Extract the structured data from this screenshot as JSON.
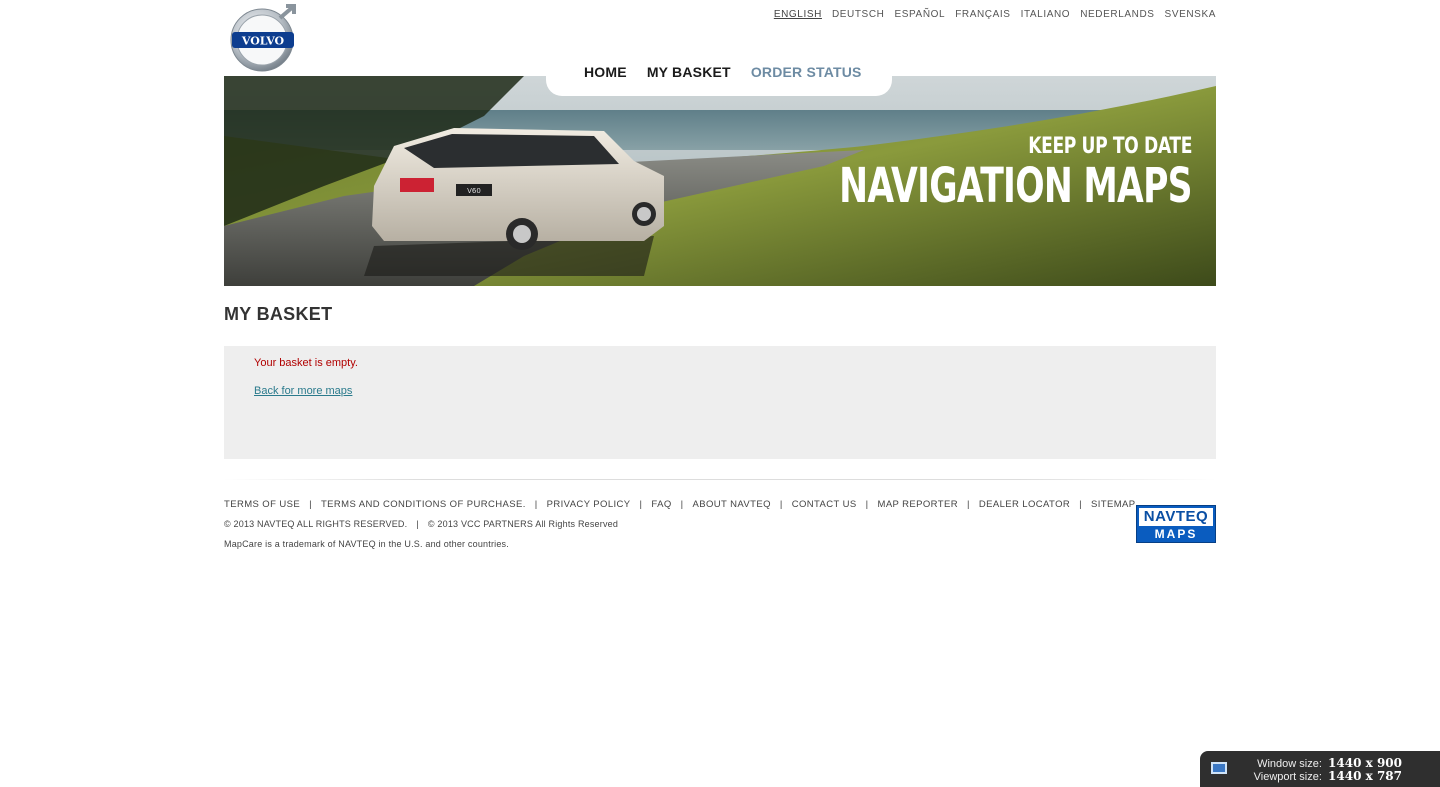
{
  "brand": {
    "logo_text": "VOLVO"
  },
  "languages": [
    {
      "label": "ENGLISH",
      "active": true
    },
    {
      "label": "DEUTSCH",
      "active": false
    },
    {
      "label": "ESPAÑOL",
      "active": false
    },
    {
      "label": "FRANÇAIS",
      "active": false
    },
    {
      "label": "ITALIANO",
      "active": false
    },
    {
      "label": "NEDERLANDS",
      "active": false
    },
    {
      "label": "SVENSKA",
      "active": false
    }
  ],
  "nav": {
    "home": "HOME",
    "basket": "MY BASKET",
    "order_status": "ORDER STATUS"
  },
  "hero": {
    "line1": "KEEP UP TO DATE",
    "line2": "NAVIGATION MAPS",
    "car_badge": "V60"
  },
  "page": {
    "title": "MY BASKET",
    "empty_message": "Your basket is empty.",
    "back_link": "Back for more maps"
  },
  "footer": {
    "links": [
      "TERMS OF USE",
      "TERMS AND CONDITIONS OF PURCHASE.",
      "PRIVACY POLICY",
      "FAQ",
      "ABOUT NAVTEQ",
      "CONTACT US",
      "MAP REPORTER",
      "DEALER LOCATOR",
      "SITEMAP"
    ],
    "copyright_navteq": "© 2013 NAVTEQ ALL RIGHTS RESERVED.",
    "copyright_vcc": "© 2013 VCC PARTNERS All Rights Reserved",
    "trademark": "MapCare is a trademark of NAVTEQ in the U.S. and other countries.",
    "partner_logo_line1": "NAVTEQ",
    "partner_logo_line2": "MAPS"
  },
  "overlay": {
    "window_label": "Window size:",
    "window_value": "1440 x 900",
    "viewport_label": "Viewport size:",
    "viewport_value": "1440 x 787"
  },
  "colors": {
    "nav_dim": "#6d8ba3",
    "error": "#b10000",
    "link": "#2a7a8c",
    "box_bg": "#eeeeee"
  }
}
